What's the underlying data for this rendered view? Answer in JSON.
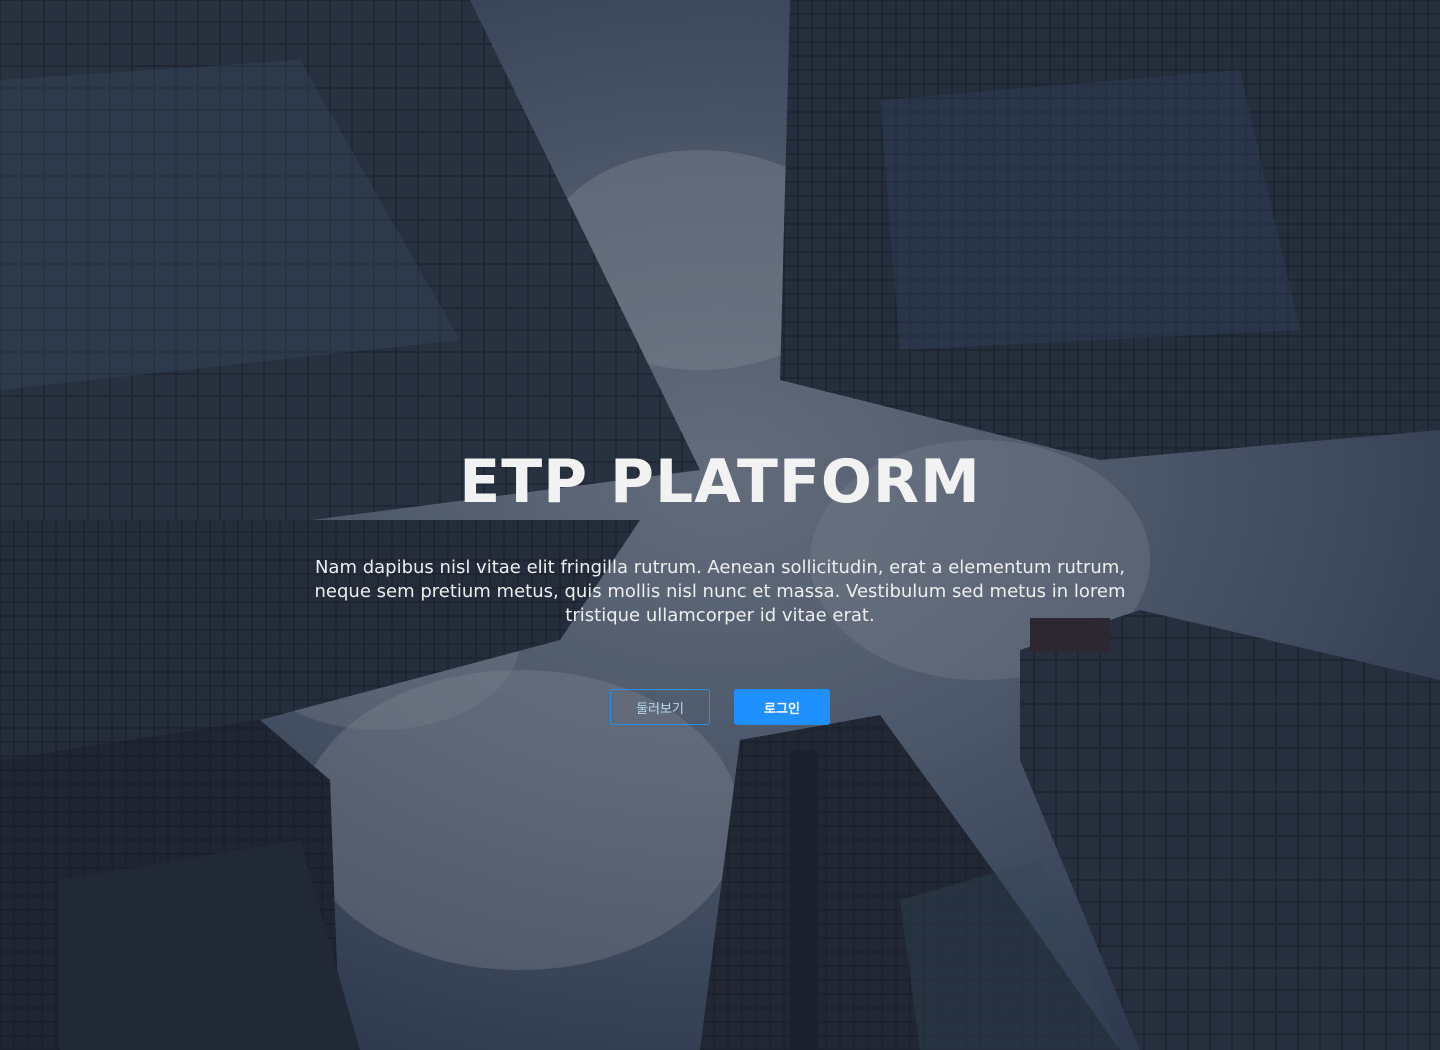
{
  "hero": {
    "title": "ETP PLATFORM",
    "description": "Nam dapibus nisl vitae elit fringilla rutrum. Aenean sollicitudin, erat a elementum rutrum, neque sem pretium metus, quis mollis nisl nunc et massa. Vestibulum sed metus in lorem tristique ullamcorper id vitae erat.",
    "buttons": {
      "browse_label": "둘러보기",
      "login_label": "로그인"
    }
  },
  "colors": {
    "accent": "#1e90ff",
    "overlay": "#1e2430"
  }
}
